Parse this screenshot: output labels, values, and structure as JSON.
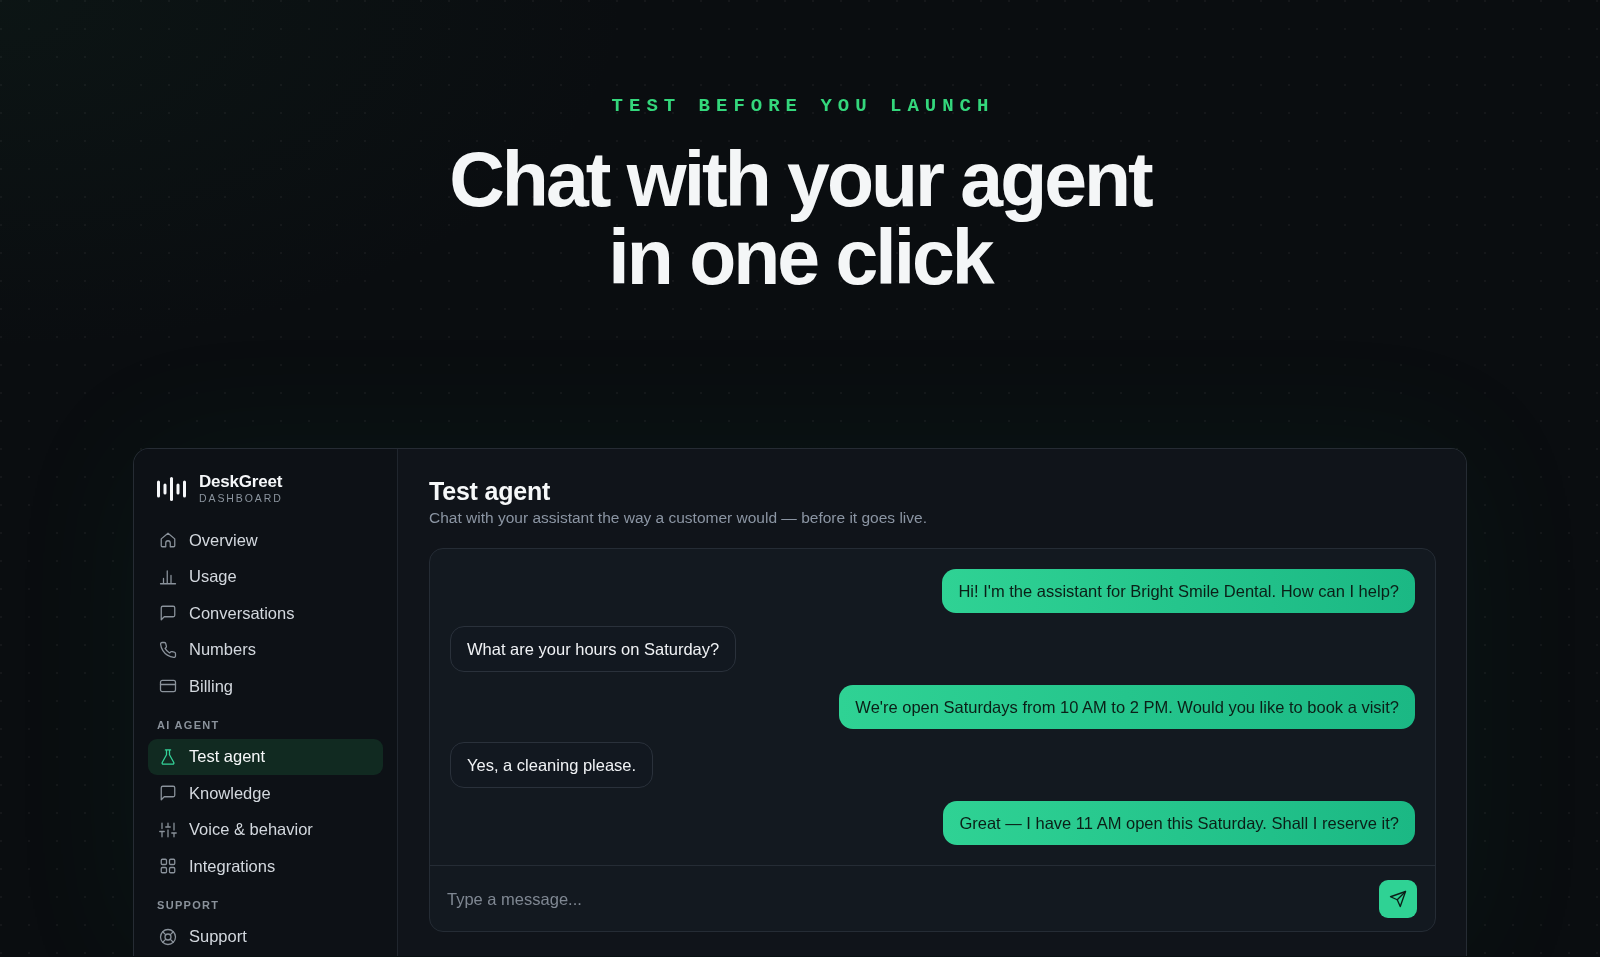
{
  "hero": {
    "eyebrow": "TEST BEFORE YOU LAUNCH",
    "title": "Chat with your agent in one click"
  },
  "sidebar": {
    "brand": {
      "name": "DeskGreet",
      "subtitle": "DASHBOARD"
    },
    "sections": [
      {
        "items": [
          {
            "label": "Overview",
            "selected": false
          },
          {
            "label": "Usage",
            "selected": false
          },
          {
            "label": "Conversations",
            "selected": false
          },
          {
            "label": "Numbers",
            "selected": false
          },
          {
            "label": "Billing",
            "selected": false
          }
        ]
      },
      {
        "heading": "AI AGENT",
        "items": [
          {
            "label": "Test agent",
            "selected": true
          },
          {
            "label": "Knowledge",
            "selected": false
          },
          {
            "label": "Voice & behavior",
            "selected": false
          },
          {
            "label": "Integrations",
            "selected": false
          }
        ]
      },
      {
        "heading": "SUPPORT",
        "items": [
          {
            "label": "Support",
            "selected": false
          }
        ]
      }
    ]
  },
  "main": {
    "title": "Test agent",
    "subtitle": "Chat with your assistant the way a customer would — before it goes live.",
    "messages": [
      {
        "kind": "agent",
        "text": "Hi! I'm the assistant for Bright Smile Dental. How can I help?"
      },
      {
        "kind": "customer",
        "text": "What are your hours on Saturday?"
      },
      {
        "kind": "agent",
        "text": "We're open Saturdays from 10 AM to 2 PM. Would you like to book a visit?"
      },
      {
        "kind": "customer",
        "text": "Yes, a cleaning please."
      },
      {
        "kind": "agent",
        "text": "Great — I have 11 AM open this Saturday. Shall I reserve it?"
      }
    ],
    "composer": {
      "placeholder": "Type a message..."
    }
  }
}
